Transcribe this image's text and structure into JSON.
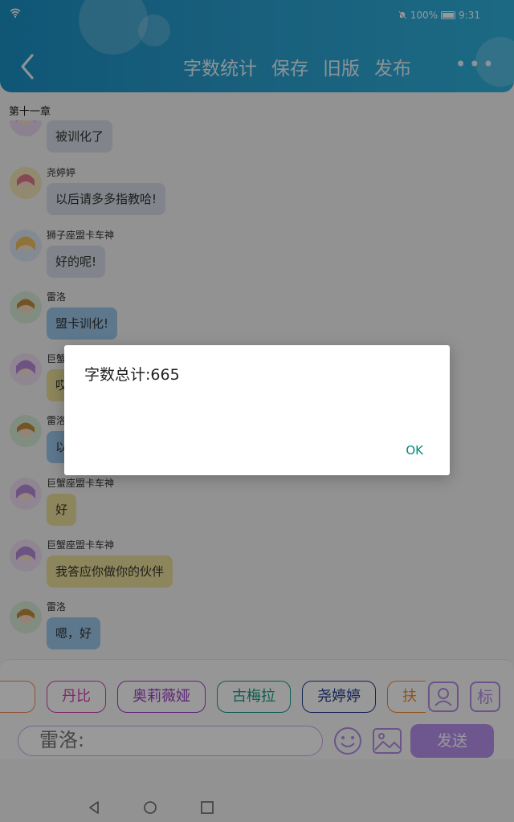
{
  "status": {
    "battery": "100%",
    "time": "9:31"
  },
  "header": {
    "actions": [
      "字数统计",
      "保存",
      "旧版",
      "发布"
    ],
    "more_label": "•••"
  },
  "chapter_title": "第十一章",
  "messages": [
    {
      "name": "",
      "text": "被训化了",
      "bubble": "gray"
    },
    {
      "name": "尧婷婷",
      "text": "以后请多多指教哈!",
      "bubble": "gray"
    },
    {
      "name": "狮子座盟卡车神",
      "text": "好的呢!",
      "bubble": "gray"
    },
    {
      "name": "雷洛",
      "text": "盟卡训化!",
      "bubble": "blue"
    },
    {
      "name": "巨蟹座盟卡车神",
      "text": "哎",
      "bubble": "yellow"
    },
    {
      "name": "雷洛",
      "text": "以",
      "bubble": "blue"
    },
    {
      "name": "巨蟹座盟卡车神",
      "text": "好",
      "bubble": "yellow"
    },
    {
      "name": "巨蟹座盟卡车神",
      "text": "我答应你做你的伙伴",
      "bubble": "yellow"
    },
    {
      "name": "雷洛",
      "text": "嗯，好",
      "bubble": "blue"
    }
  ],
  "characters": [
    {
      "label": "",
      "color": "#f08a5d"
    },
    {
      "label": "丹比",
      "color": "#d63fb0"
    },
    {
      "label": "奥莉薇娅",
      "color": "#9b3fc8"
    },
    {
      "label": "古梅拉",
      "color": "#1a9b86"
    },
    {
      "label": "尧婷婷",
      "color": "#1f3a8a"
    },
    {
      "label": "扶",
      "color": "#f08a2d"
    }
  ],
  "tag_button_label": "标",
  "input": {
    "value": "雷洛:"
  },
  "send_label": "发送",
  "dialog": {
    "message": "字数总计:665",
    "ok_label": "OK"
  }
}
